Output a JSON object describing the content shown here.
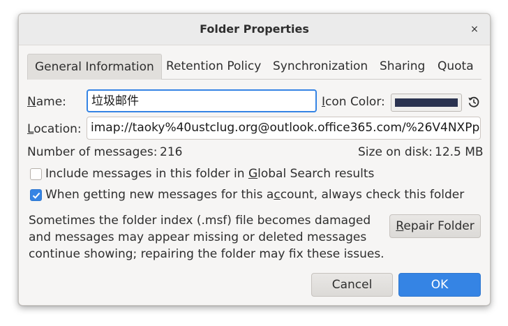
{
  "dialog": {
    "title": "Folder Properties",
    "close_glyph": "×"
  },
  "tabs": [
    {
      "label": "General Information",
      "active": true
    },
    {
      "label": "Retention Policy",
      "active": false
    },
    {
      "label": "Synchronization",
      "active": false
    },
    {
      "label": "Sharing",
      "active": false
    },
    {
      "label": "Quota",
      "active": false
    }
  ],
  "form": {
    "name_label_first": "N",
    "name_label_rest": "ame:",
    "name_value": "垃圾邮件",
    "icon_color_label_first": "I",
    "icon_color_label_rest": "con Color:",
    "icon_color_value": "#2b3350",
    "location_label_first": "L",
    "location_label_rest": "ocation:",
    "location_value": "imap://taoky%40ustclug.org@outlook.office365.com/%26V4NXPp",
    "messages_label": "Number of messages:",
    "messages_value": "216",
    "size_label": "Size on disk:",
    "size_value": "12.5 MB"
  },
  "options": {
    "global_search_before": "Include messages in this folder in ",
    "global_search_accel": "G",
    "global_search_after": "lobal Search results",
    "global_search_checked": false,
    "check_folder_before": "When getting new messages for this a",
    "check_folder_accel": "c",
    "check_folder_after": "count, always check this folder",
    "check_folder_checked": true
  },
  "repair": {
    "description": "Sometimes the folder index (.msf) file becomes damaged and messages may appear missing or deleted messages continue showing; repairing the folder may fix these issues.",
    "button_first": "R",
    "button_rest": "epair Folder"
  },
  "buttons": {
    "cancel": "Cancel",
    "ok": "OK"
  },
  "icons": {
    "close": "close-icon",
    "reset": "reset-color-icon",
    "check": "checkmark-icon"
  }
}
